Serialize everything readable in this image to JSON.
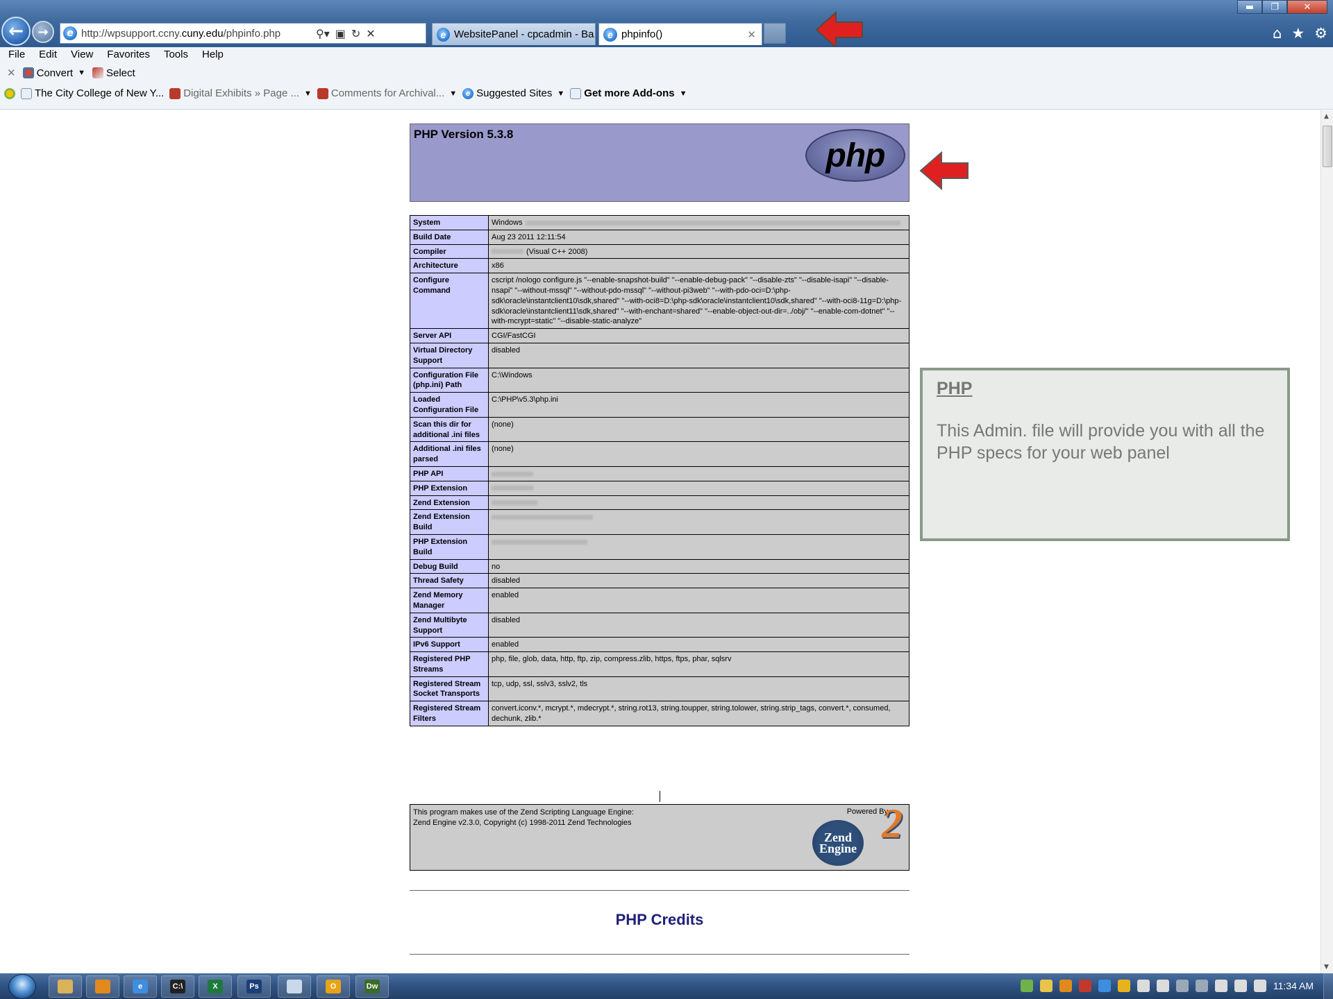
{
  "browser": {
    "url_prefix": "http://wpsupport.ccny.",
    "url_domain": "cuny.edu",
    "url_suffix": "/phpinfo.php",
    "tabs": [
      {
        "label": "WebsitePanel - cpcadmin - Ba..."
      },
      {
        "label": "phpinfo()"
      }
    ],
    "menu": [
      "File",
      "Edit",
      "View",
      "Favorites",
      "Tools",
      "Help"
    ],
    "commands": {
      "convert": "Convert",
      "select": "Select"
    },
    "favorites": [
      {
        "label": "The City College of New Y..."
      },
      {
        "label": "Digital Exhibits » Page ..."
      },
      {
        "label": "Comments for Archival..."
      },
      {
        "label": "Suggested Sites"
      },
      {
        "label": "Get more Add-ons"
      }
    ]
  },
  "phpinfo": {
    "version_title": "PHP Version 5.3.8",
    "logo_text": "php",
    "rows": [
      {
        "key": "System",
        "value": "Windows"
      },
      {
        "key": "Build Date",
        "value": "Aug 23 2011 12:11:54"
      },
      {
        "key": "Compiler",
        "value": "(Visual C++ 2008)"
      },
      {
        "key": "Architecture",
        "value": "x86"
      },
      {
        "key": "Configure Command",
        "value": "cscript /nologo configure.js \"--enable-snapshot-build\" \"--enable-debug-pack\" \"--disable-zts\" \"--disable-isapi\" \"--disable-nsapi\" \"--without-mssql\" \"--without-pdo-mssql\" \"--without-pi3web\" \"--with-pdo-oci=D:\\php-sdk\\oracle\\instantclient10\\sdk,shared\" \"--with-oci8=D:\\php-sdk\\oracle\\instantclient10\\sdk,shared\" \"--with-oci8-11g=D:\\php-sdk\\oracle\\instantclient11\\sdk,shared\" \"--with-enchant=shared\" \"--enable-object-out-dir=../obj/\" \"--enable-com-dotnet\" \"--with-mcrypt=static\" \"--disable-static-analyze\""
      },
      {
        "key": "Server API",
        "value": "CGI/FastCGI"
      },
      {
        "key": "Virtual Directory Support",
        "value": "disabled"
      },
      {
        "key": "Configuration File (php.ini) Path",
        "value": "C:\\Windows"
      },
      {
        "key": "Loaded Configuration File",
        "value": "C:\\PHP\\v5.3\\php.ini"
      },
      {
        "key": "Scan this dir for additional .ini files",
        "value": "(none)"
      },
      {
        "key": "Additional .ini files parsed",
        "value": "(none)"
      },
      {
        "key": "PHP API",
        "value": ""
      },
      {
        "key": "PHP Extension",
        "value": ""
      },
      {
        "key": "Zend Extension",
        "value": ""
      },
      {
        "key": "Zend Extension Build",
        "value": ""
      },
      {
        "key": "PHP Extension Build",
        "value": ""
      },
      {
        "key": "Debug Build",
        "value": "no"
      },
      {
        "key": "Thread Safety",
        "value": "disabled"
      },
      {
        "key": "Zend Memory Manager",
        "value": "enabled"
      },
      {
        "key": "Zend Multibyte Support",
        "value": "disabled"
      },
      {
        "key": "IPv6 Support",
        "value": "enabled"
      },
      {
        "key": "Registered PHP Streams",
        "value": "php, file, glob, data, http, ftp, zip, compress.zlib, https, ftps, phar, sqlsrv"
      },
      {
        "key": "Registered Stream Socket Transports",
        "value": "tcp, udp, ssl, sslv3, sslv2, tls"
      },
      {
        "key": "Registered Stream Filters",
        "value": "convert.iconv.*, mcrypt.*, mdecrypt.*, string.rot13, string.toupper, string.tolower, string.strip_tags, convert.*, consumed, dechunk, zlib.*"
      }
    ],
    "zend_line1": "This program makes use of the Zend Scripting Language Engine:",
    "zend_line2": "Zend Engine v2.3.0, Copyright (c) 1998-2011 Zend Technologies",
    "powered_by": "Powered By",
    "zend_logo_line1": "Zend",
    "zend_logo_line2": "Engine",
    "zend_logo_num": "2",
    "credits_title": "PHP Credits"
  },
  "callout": {
    "title": "PHP",
    "body": "This Admin. file will provide you with all the PHP specs for your web panel"
  },
  "taskbar": {
    "apps": [
      {
        "label": ""
      },
      {
        "label": ""
      },
      {
        "label": "e"
      },
      {
        "label": "C:\\"
      },
      {
        "label": "X"
      },
      {
        "label": "Ps"
      },
      {
        "label": ""
      },
      {
        "label": "O"
      },
      {
        "label": "Dw"
      }
    ],
    "clock": "11:34 AM"
  },
  "colors": {
    "php_header_bg": "#9999cc",
    "key_cell_bg": "#ccccff",
    "value_cell_bg": "#cccccc",
    "arrow_red": "#e02020"
  }
}
